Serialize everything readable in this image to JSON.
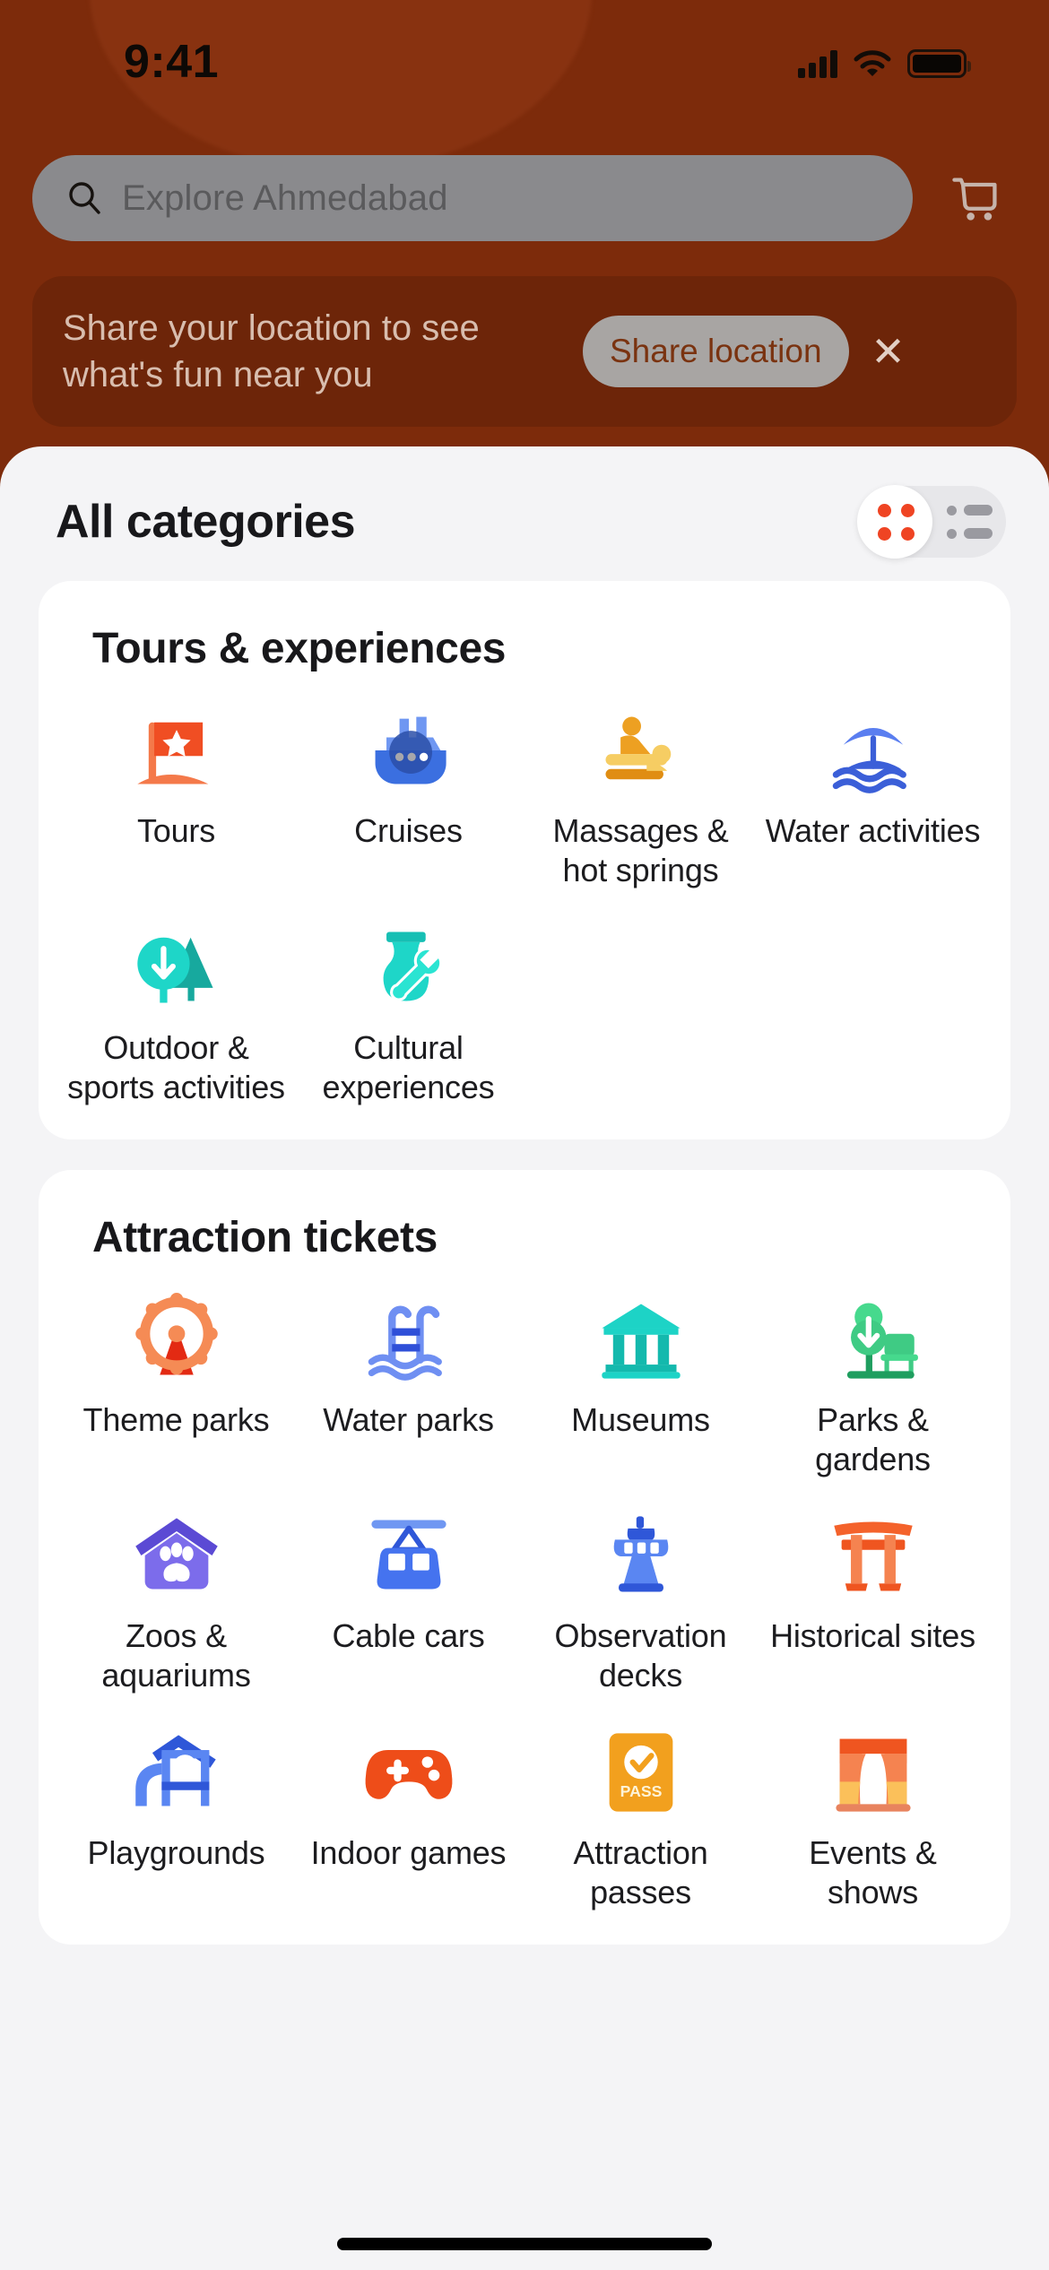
{
  "status_bar": {
    "time": "9:41",
    "signal_icon": "cellular-signal-icon",
    "wifi_icon": "wifi-icon",
    "battery_icon": "battery-icon"
  },
  "header": {
    "background_color": "#7d2b0b",
    "search": {
      "placeholder": "Explore Ahmedabad",
      "icon": "search-icon"
    },
    "cart_icon": "shopping-cart-icon"
  },
  "location_banner": {
    "message": "Share your location to see what's fun near you",
    "share_button_label": "Share location",
    "close_icon": "close-icon"
  },
  "sheet": {
    "title": "All categories",
    "view_toggle": {
      "grid_label": "grid-view",
      "list_label": "list-view",
      "active": "grid-view",
      "accent_color": "#ef4423"
    }
  },
  "sections": [
    {
      "title": "Tours & experiences",
      "items": [
        {
          "label": "Tours",
          "icon": "flag-icon",
          "color": "#f04e23"
        },
        {
          "label": "Cruises",
          "icon": "cruise-ship-icon",
          "color": "#3b6fe0"
        },
        {
          "label": "Massages & hot springs",
          "icon": "massage-icon",
          "color": "#eda022"
        },
        {
          "label": "Water activities",
          "icon": "beach-umbrella-icon",
          "color": "#5a7ef0"
        },
        {
          "label": "Outdoor & sports activities",
          "icon": "trees-icon",
          "color": "#1ed6c8"
        },
        {
          "label": "Cultural experiences",
          "icon": "vase-wrench-icon",
          "color": "#1ed6c8"
        }
      ]
    },
    {
      "title": "Attraction tickets",
      "items": [
        {
          "label": "Theme parks",
          "icon": "ferris-wheel-icon",
          "color": "#f58b55"
        },
        {
          "label": "Water parks",
          "icon": "pool-ladder-icon",
          "color": "#6f8ff2"
        },
        {
          "label": "Museums",
          "icon": "museum-icon",
          "color": "#1dd3c6"
        },
        {
          "label": "Parks & gardens",
          "icon": "tree-bench-icon",
          "color": "#3fcb84"
        },
        {
          "label": "Zoos & aquariums",
          "icon": "pet-house-icon",
          "color": "#7c6ceb"
        },
        {
          "label": "Cable cars",
          "icon": "cable-car-icon",
          "color": "#4573ef"
        },
        {
          "label": "Observation decks",
          "icon": "observation-tower-icon",
          "color": "#5a86f2"
        },
        {
          "label": "Historical sites",
          "icon": "torii-gate-icon",
          "color": "#f4622b"
        },
        {
          "label": "Playgrounds",
          "icon": "playground-icon",
          "color": "#5a86f2"
        },
        {
          "label": "Indoor games",
          "icon": "game-controller-icon",
          "color": "#ee4d19"
        },
        {
          "label": "Attraction passes",
          "icon": "pass-card-icon",
          "color": "#f2a01e",
          "badge_text": "PASS"
        },
        {
          "label": "Events & shows",
          "icon": "theater-curtain-icon",
          "color": "#f4622b"
        }
      ]
    }
  ]
}
